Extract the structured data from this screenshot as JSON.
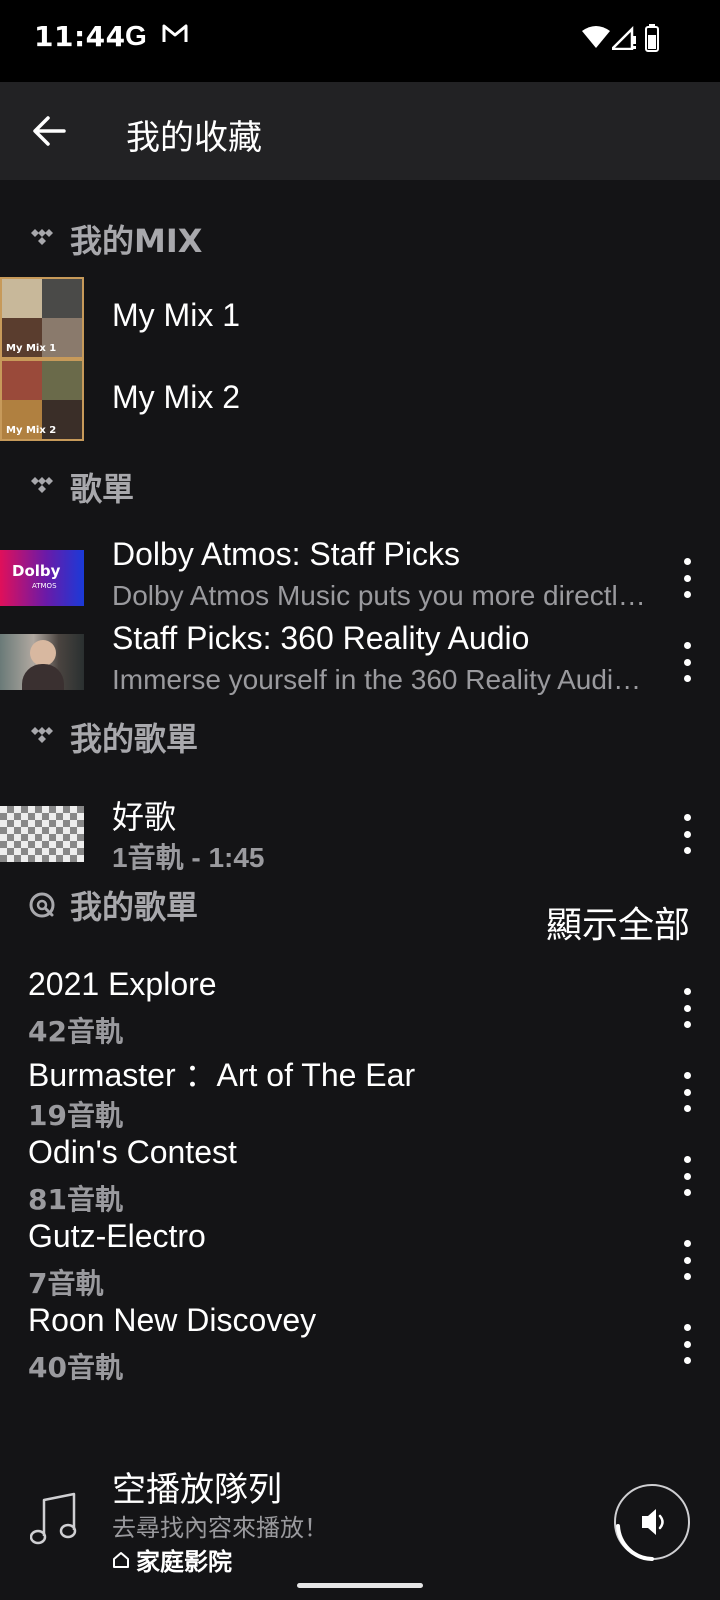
{
  "status_bar": {
    "time": "11:44",
    "g_label": "G"
  },
  "header": {
    "title": "我的收藏",
    "back_icon": "arrow-left-icon"
  },
  "mix_section": {
    "title": "我的MIX",
    "items": [
      {
        "title": "My Mix 1",
        "thumb_label": "My Mix 1"
      },
      {
        "title": "My Mix 2",
        "thumb_label": "My Mix 2"
      }
    ]
  },
  "playlists_section": {
    "title": "歌單",
    "items": [
      {
        "title": "Dolby Atmos: Staff Picks",
        "subtitle": "Dolby Atmos Music puts you more directl…",
        "thumb_text": "Dolby",
        "thumb_sub": "ATMOS"
      },
      {
        "title": "Staff Picks: 360 Reality Audio",
        "subtitle": "Immerse yourself in the 360 Reality Audi…"
      }
    ]
  },
  "my_playlists_section": {
    "title": "我的歌單",
    "items": [
      {
        "title": "好歌",
        "subtitle": "1音軌 - 1:45"
      }
    ]
  },
  "roon_playlists_section": {
    "title": "我的歌單",
    "show_all": "顯示全部",
    "items": [
      {
        "title": "2021 Explore",
        "subtitle": "42音軌"
      },
      {
        "title": "Burmaster ：Art of The Ear",
        "subtitle": "19音軌"
      },
      {
        "title": "Odin's Contest",
        "subtitle": "81音軌"
      },
      {
        "title": "Gutz-Electro",
        "subtitle": "7音軌"
      },
      {
        "title": "Roon New Discovey",
        "subtitle": "40音軌"
      }
    ]
  },
  "now_playing": {
    "title": "空播放隊列",
    "subtitle": "去尋找內容來播放！",
    "zone": "家庭影院",
    "zone_icon": "home-icon",
    "volume_icon": "speaker-icon"
  },
  "colors": {
    "background": "#141416",
    "appbar": "#222224",
    "secondary_text": "#9a9a9e",
    "mix_border": "#c79a5a"
  }
}
